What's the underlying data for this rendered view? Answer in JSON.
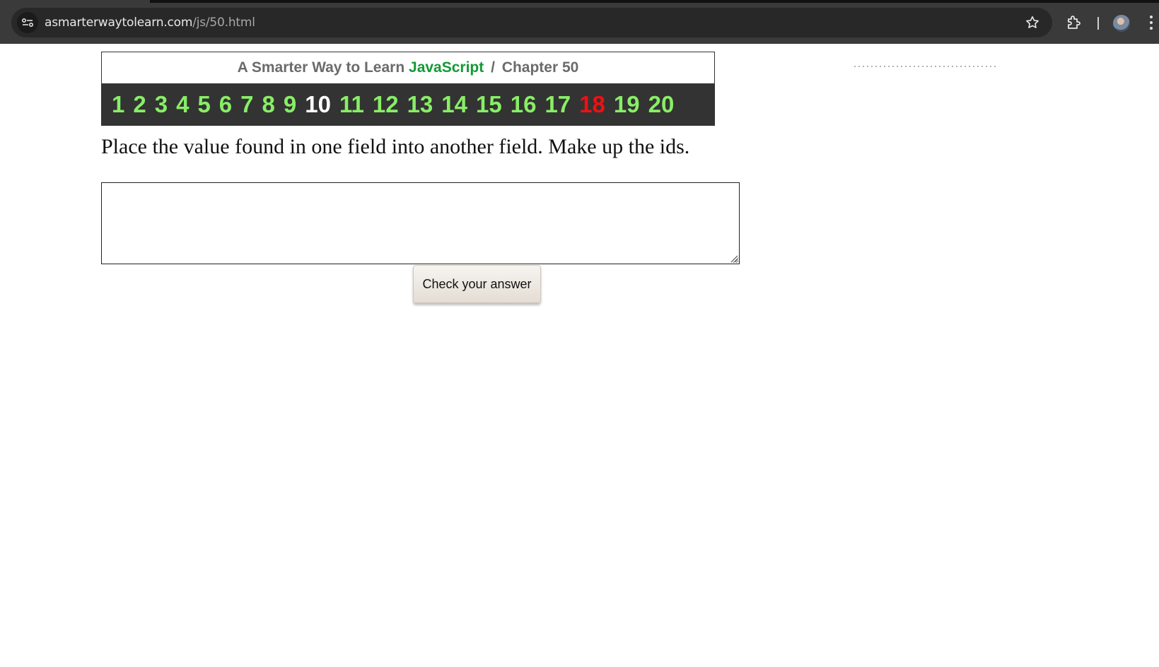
{
  "browser": {
    "url_host": "asmarterwaytolearn.com",
    "url_path": "/js/50.html"
  },
  "header": {
    "title_prefix": "A Smarter Way to Learn",
    "title_brand": "JavaScript",
    "separator": "/",
    "chapter": "Chapter 50",
    "brand_color": "#129a35"
  },
  "chapters": [
    "1",
    "2",
    "3",
    "4",
    "5",
    "6",
    "7",
    "8",
    "9",
    "10",
    "11",
    "12",
    "13",
    "14",
    "15",
    "16",
    "17",
    "18",
    "19",
    "20"
  ],
  "chapters_current": "10",
  "chapters_highlight": "18",
  "colors": {
    "chapter_default": "#88ee66",
    "chapter_current": "#ffffff",
    "chapter_highlight": "#ee1111"
  },
  "exercise": {
    "prompt": "Place the value found in one field into another field. Make up the ids.",
    "answer_value": "",
    "check_button": "Check your answer"
  }
}
